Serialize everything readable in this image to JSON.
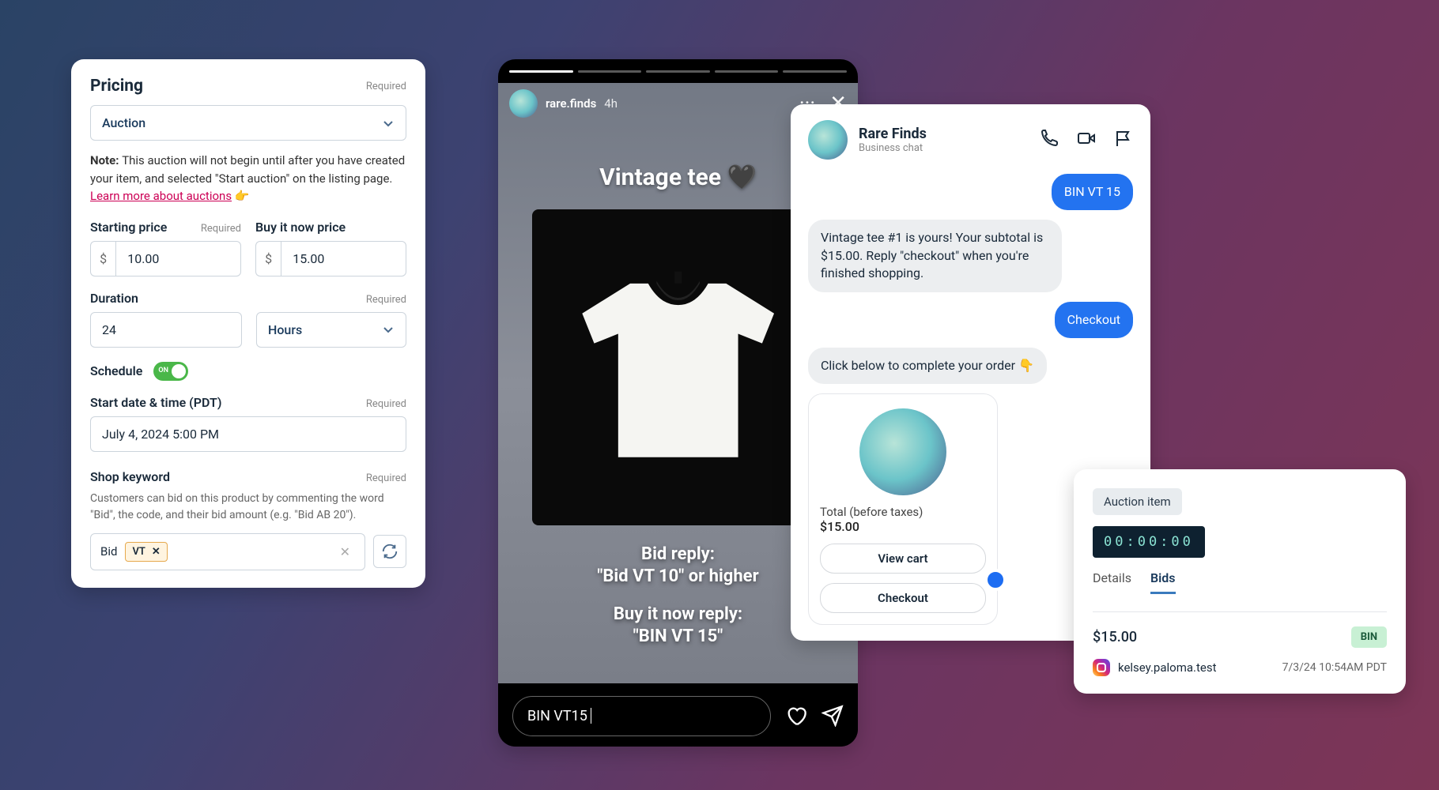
{
  "pricing": {
    "title": "Pricing",
    "required": "Required",
    "type_label": "Auction",
    "note_prefix": "Note: ",
    "note_text": "This auction will not begin until after you have created your item, and selected \"Start auction\" on the listing page. ",
    "note_link": "Learn more about auctions",
    "note_emoji": " 👉",
    "starting_label": "Starting price",
    "starting_value": "10.00",
    "bin_label": "Buy it now price",
    "bin_value": "15.00",
    "currency": "$",
    "duration_label": "Duration",
    "duration_value": "24",
    "duration_unit": "Hours",
    "schedule_label": "Schedule",
    "schedule_on": "ON",
    "start_label": "Start date & time (PDT)",
    "start_value": "July 4, 2024 5:00 PM",
    "keyword_label": "Shop keyword",
    "keyword_help": "Customers can bid on this product by commenting the word \"Bid\", the code, and their bid amount (e.g. \"Bid AB 20\").",
    "keyword_prefix": "Bid",
    "keyword_chip": "VT",
    "keyword_chip_x": "✕",
    "keyword_clear": "✕"
  },
  "story": {
    "username": "rare.finds",
    "time": "4h",
    "more": "···",
    "close": "✕",
    "title": "Vintage tee 🖤",
    "bid_label": "Bid reply:",
    "bid_text": "\"Bid VT 10\" or higher",
    "bin_label": "Buy it now reply:",
    "bin_text": "\"BIN VT 15\"",
    "input_text": "BIN VT15 "
  },
  "chat": {
    "name": "Rare Finds",
    "subtitle": "Business chat",
    "msg1": "BIN VT 15",
    "msg2": "Vintage tee #1 is yours! Your subtotal is $15.00. Reply \"checkout\" when you're finished shopping.",
    "msg3": "Checkout",
    "msg4": "Click below to complete your order 👇",
    "total_label": "Total (before taxes)",
    "total_amount": "$15.00",
    "view_cart": "View cart",
    "checkout": "Checkout"
  },
  "bids": {
    "badge": "Auction item",
    "timer": "00:00:00",
    "tab_details": "Details",
    "tab_bids": "Bids",
    "price": "$15.00",
    "bin": "BIN",
    "username": "kelsey.paloma.test",
    "timestamp": "7/3/24 10:54AM PDT"
  }
}
